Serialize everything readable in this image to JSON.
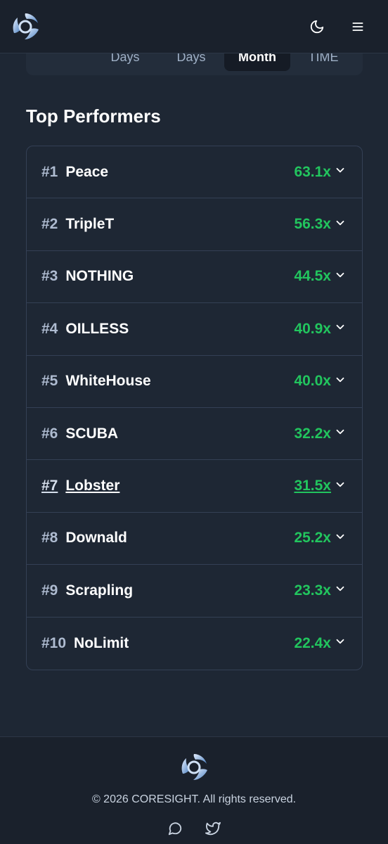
{
  "header": {
    "logo_icon": "coresight-logo-icon",
    "theme_icon": "moon-icon",
    "menu_icon": "hamburger-menu-icon"
  },
  "period_tabs": [
    {
      "label": "",
      "active": false
    },
    {
      "label": "Days",
      "active": false
    },
    {
      "label": "Days",
      "active": false
    },
    {
      "label": "Month",
      "active": true
    },
    {
      "label": "TIME",
      "active": false
    }
  ],
  "section": {
    "title": "Top Performers"
  },
  "performers": [
    {
      "rank": "#1",
      "name": "Peace",
      "multiplier": "63.1x"
    },
    {
      "rank": "#2",
      "name": "TripleT",
      "multiplier": "56.3x"
    },
    {
      "rank": "#3",
      "name": "NOTHING",
      "multiplier": "44.5x"
    },
    {
      "rank": "#4",
      "name": "OILLESS",
      "multiplier": "40.9x"
    },
    {
      "rank": "#5",
      "name": "WhiteHouse",
      "multiplier": "40.0x"
    },
    {
      "rank": "#6",
      "name": "SCUBA",
      "multiplier": "32.2x"
    },
    {
      "rank": "#7",
      "name": "Lobster",
      "multiplier": "31.5x"
    },
    {
      "rank": "#8",
      "name": "Downald",
      "multiplier": "25.2x"
    },
    {
      "rank": "#9",
      "name": "Scrapling",
      "multiplier": "23.3x"
    },
    {
      "rank": "#10",
      "name": "NoLimit",
      "multiplier": "22.4x"
    }
  ],
  "hovered_row": 6,
  "footer": {
    "copyright": "© 2026 CORESIGHT. All rights reserved.",
    "social": [
      "chat-bubble-icon",
      "twitter-icon"
    ]
  },
  "colors": {
    "background": "#1e2734",
    "header": "#1a212c",
    "accent_green": "#22c55e",
    "border": "#344055",
    "active_tab": "#151b25"
  }
}
